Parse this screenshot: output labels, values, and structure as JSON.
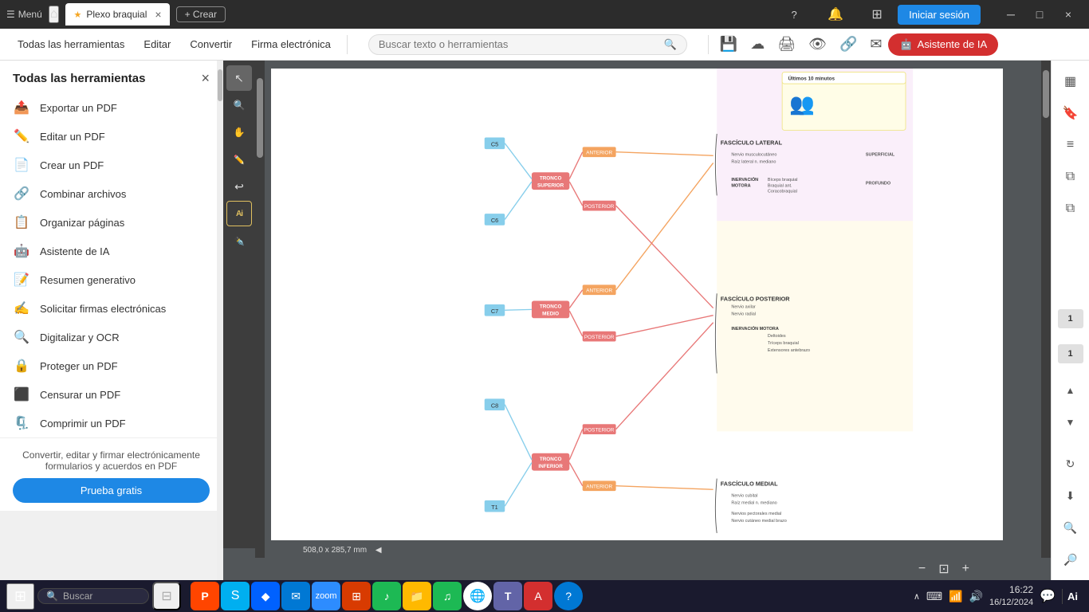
{
  "titlebar": {
    "menu_label": "Menú",
    "home_icon": "⌂",
    "tab_label": "Plexo braquial",
    "tab_close": "×",
    "new_tab_label": "+ Crear",
    "iniciar_label": "Iniciar sesión",
    "help_icon": "?",
    "notif_icon": "🔔",
    "apps_icon": "⊞",
    "minimize_icon": "─",
    "maximize_icon": "□",
    "close_icon": "×"
  },
  "toolbar": {
    "all_tools_label": "Todas las herramientas",
    "edit_label": "Editar",
    "convert_label": "Convertir",
    "firma_label": "Firma electrónica",
    "search_placeholder": "Buscar texto o herramientas",
    "ai_btn_label": "Asistente de IA"
  },
  "sidebar": {
    "title": "Todas las herramientas",
    "close_label": "×",
    "items": [
      {
        "id": "exportar",
        "icon": "📤",
        "label": "Exportar un PDF",
        "color": "red"
      },
      {
        "id": "editar",
        "icon": "✏️",
        "label": "Editar un PDF",
        "color": "red"
      },
      {
        "id": "crear",
        "icon": "📄",
        "label": "Crear un PDF",
        "color": "red"
      },
      {
        "id": "combinar",
        "icon": "🔗",
        "label": "Combinar archivos",
        "color": "blue"
      },
      {
        "id": "organizar",
        "icon": "📋",
        "label": "Organizar páginas",
        "color": "green"
      },
      {
        "id": "ia",
        "icon": "🤖",
        "label": "Asistente de IA",
        "color": "blue"
      },
      {
        "id": "resumen",
        "icon": "📝",
        "label": "Resumen generativo",
        "color": "blue"
      },
      {
        "id": "firmas",
        "icon": "✍️",
        "label": "Solicitar firmas electrónicas",
        "color": "blue"
      },
      {
        "id": "ocr",
        "icon": "🔍",
        "label": "Digitalizar y OCR",
        "color": "green"
      },
      {
        "id": "proteger",
        "icon": "🔒",
        "label": "Proteger un PDF",
        "color": "purple"
      },
      {
        "id": "censurar",
        "icon": "⬛",
        "label": "Censurar un PDF",
        "color": "red"
      },
      {
        "id": "comprimir",
        "icon": "🗜️",
        "label": "Comprimir un PDF",
        "color": "red"
      }
    ],
    "footer_text": "Convertir, editar y firmar electrónicamente formularios y acuerdos en PDF",
    "trial_btn": "Prueba gratis"
  },
  "pdf_viewer": {
    "page_size": "508,0 x 285,7 mm",
    "page_num_1": "1",
    "page_num_2": "1"
  },
  "ultimos": {
    "header": "Últimos 10 minutos"
  },
  "taskbar": {
    "search_placeholder": "Buscar",
    "time": "16:22",
    "date": "16/12/2024",
    "ai_label": "Ai"
  },
  "left_tools": [
    {
      "id": "select",
      "icon": "↖",
      "title": "Seleccionar"
    },
    {
      "id": "zoom",
      "icon": "🔍",
      "title": "Zoom"
    },
    {
      "id": "hand",
      "icon": "✋",
      "title": "Mano"
    },
    {
      "id": "pen",
      "icon": "✏️",
      "title": "Lápiz"
    },
    {
      "id": "curve",
      "icon": "↩",
      "title": "Curva"
    },
    {
      "id": "ai2",
      "icon": "Ai",
      "title": "IA"
    },
    {
      "id": "sign",
      "icon": "✒️",
      "title": "Firma"
    }
  ],
  "right_panel": [
    {
      "id": "thumbnail",
      "icon": "▦",
      "title": "Miniaturas"
    },
    {
      "id": "bookmark",
      "icon": "🔖",
      "title": "Marcadores"
    },
    {
      "id": "layers",
      "icon": "≡",
      "title": "Capas"
    },
    {
      "id": "copy1",
      "icon": "⧉",
      "title": "Copiar 1"
    },
    {
      "id": "copy2",
      "icon": "⧉",
      "title": "Copiar 2"
    }
  ]
}
